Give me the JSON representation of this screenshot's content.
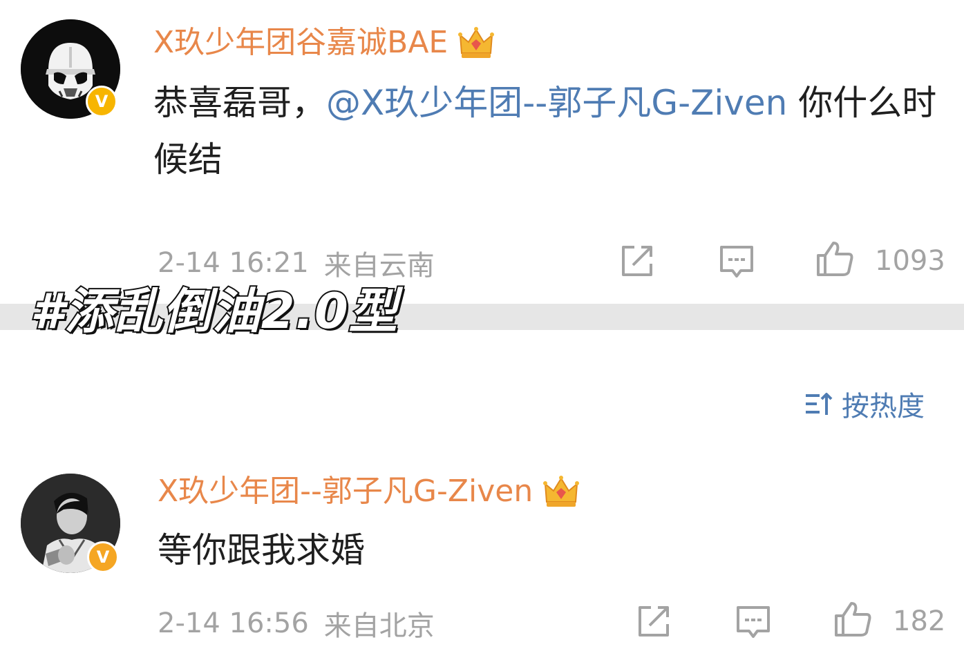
{
  "comments": [
    {
      "username": "X玖少年团谷嘉诚BAE",
      "text_before": "恭喜磊哥，",
      "mention": "@X玖少年团--郭子凡G-Ziven",
      "text_after": " 你什么时候结",
      "timestamp": "2-14 16:21",
      "location": "来自云南",
      "likes": "1093",
      "avatar_icon": "stormtrooper-avatar",
      "badge_glyph": "V"
    },
    {
      "username": "X玖少年团--郭子凡G-Ziven",
      "text": "等你跟我求婚",
      "timestamp": "2-14 16:56",
      "location": "来自北京",
      "likes": "182",
      "avatar_icon": "person-avatar",
      "badge_glyph": "V"
    }
  ],
  "overlay_caption": "#添乱倒油2.0型",
  "sort": {
    "label": "按热度",
    "icon": "sort-icon"
  },
  "icons": [
    "crown-icon",
    "repost-icon",
    "comment-icon",
    "like-icon",
    "verified-icon"
  ],
  "colors": {
    "username": "#e8874a",
    "mention": "#4f7cb3",
    "meta": "#a3a3a3",
    "badge": "#f7b500",
    "divider": "#e6e6e6"
  }
}
